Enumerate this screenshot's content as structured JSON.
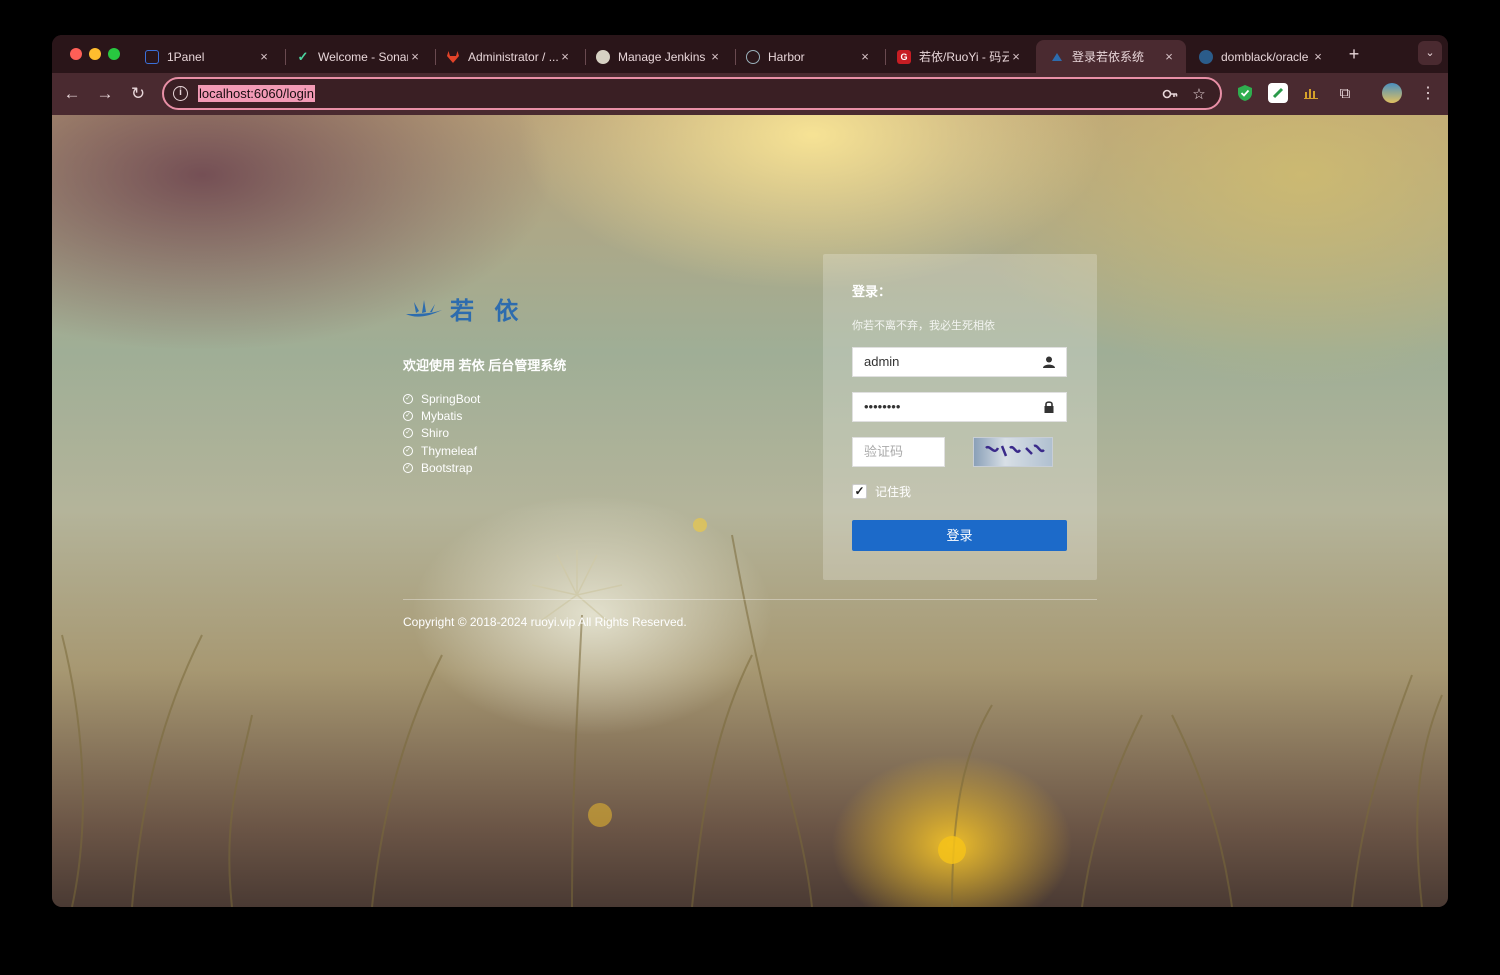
{
  "browser": {
    "tabs": [
      {
        "title": "1Panel",
        "icon": "1panel-icon",
        "color": "#3b6fd8"
      },
      {
        "title": "Welcome - Sonar",
        "icon": "sonarqube-icon",
        "color": "#4b9fd5"
      },
      {
        "title": "Administrator / ...",
        "icon": "gitlab-icon",
        "color": "#e24329"
      },
      {
        "title": "Manage Jenkins",
        "icon": "jenkins-icon",
        "color": "#d6d1c3"
      },
      {
        "title": "Harbor",
        "icon": "harbor-icon",
        "color": "#7a9aa8"
      },
      {
        "title": "若依/RuoYi - 码云",
        "icon": "gitee-icon",
        "color": "#c71d23"
      },
      {
        "title": "登录若依系统",
        "icon": "ruoyi-icon",
        "color": "#2d6cae",
        "active": true
      },
      {
        "title": "domblack/oracle",
        "icon": "docker-icon",
        "color": "#2b5c8a"
      }
    ],
    "new_tab": "+",
    "tab_menu": "⌄",
    "url": "localhost:6060/login"
  },
  "page": {
    "brand": "若 依",
    "welcome": "欢迎使用 若依 后台管理系统",
    "features": [
      "SpringBoot",
      "Mybatis",
      "Shiro",
      "Thymeleaf",
      "Bootstrap"
    ],
    "login": {
      "title": "登录：",
      "subtitle": "你若不离不弃，我必生死相依",
      "username": "admin",
      "password": "••••••••",
      "captcha_placeholder": "验证码",
      "remember_label": "记住我",
      "remember_checked": true,
      "submit": "登录"
    },
    "copyright": "Copyright © 2018-2024 ruoyi.vip All Rights Reserved."
  },
  "colors": {
    "accent": "#1c6ac9",
    "brand": "#2d6cae",
    "omnibox_border": "#e88fa6"
  }
}
